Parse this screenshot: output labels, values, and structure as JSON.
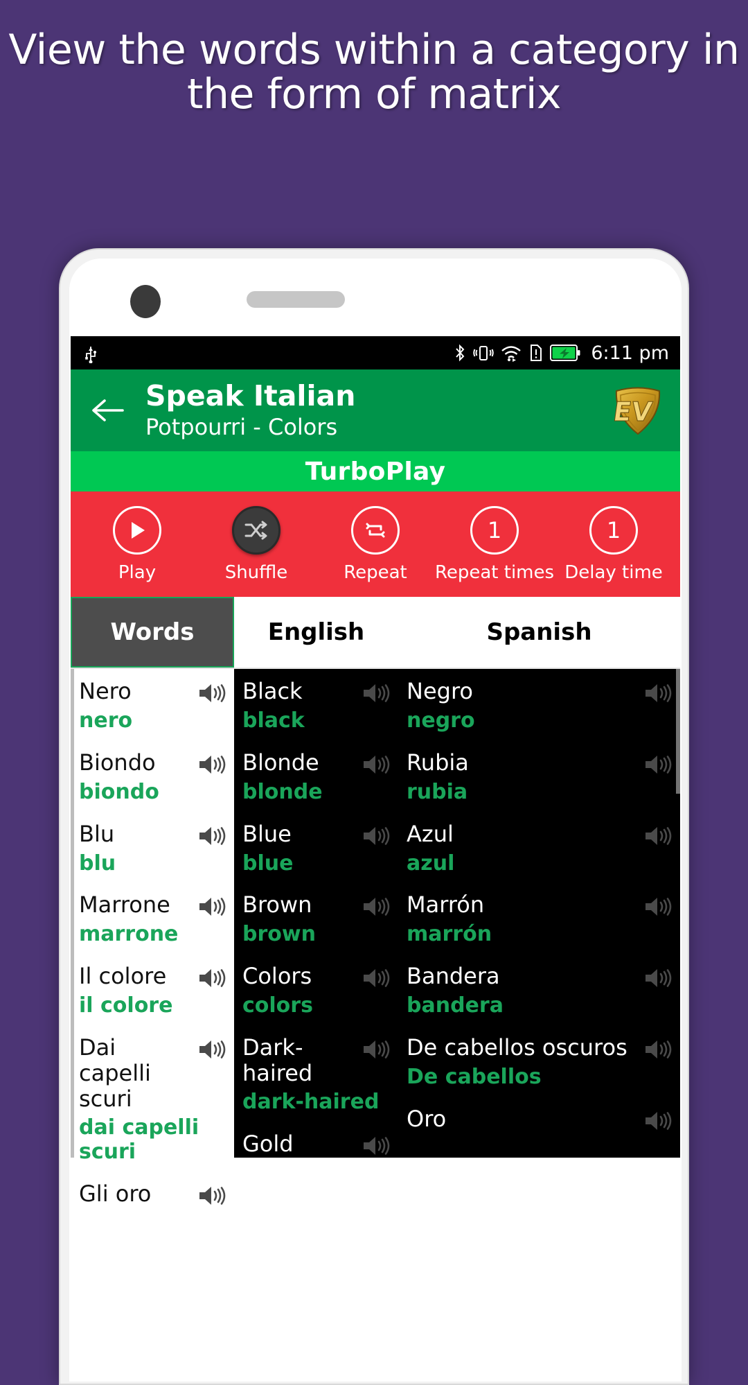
{
  "promo": {
    "headline": "View the words within a category in the form of matrix",
    "background_color": "#4c3575"
  },
  "statusbar": {
    "time": "6:11 pm",
    "left_icons": [
      "usb-icon"
    ],
    "right_icons": [
      "bluetooth-icon",
      "vibrate-icon",
      "wifi-icon",
      "sim-alert-icon",
      "battery-charging-icon"
    ]
  },
  "appbar": {
    "back_label": "←",
    "title": "Speak Italian",
    "subtitle": "Potpourri - Colors",
    "logo_text": "EV",
    "color": "#00944a"
  },
  "turboplay": {
    "label": "TurboPlay",
    "color": "#00c853"
  },
  "controls": {
    "bar_color": "#f0303c",
    "items": [
      {
        "label": "Play",
        "icon": "play-icon",
        "value": "",
        "active": false
      },
      {
        "label": "Shuffle",
        "icon": "shuffle-icon",
        "value": "",
        "active": true
      },
      {
        "label": "Repeat",
        "icon": "repeat-icon",
        "value": "",
        "active": false
      },
      {
        "label": "Repeat times",
        "icon": "number-icon",
        "value": "1",
        "active": false
      },
      {
        "label": "Delay time",
        "icon": "number-icon",
        "value": "1",
        "active": false
      }
    ]
  },
  "table": {
    "headers": {
      "words": "Words",
      "english": "English",
      "spanish": "Spanish"
    },
    "rows": [
      {
        "words_term": "Nero",
        "words_translit": "nero",
        "english_term": "Black",
        "english_translit": "black",
        "spanish_term": "Negro",
        "spanish_translit": "negro"
      },
      {
        "words_term": "Biondo",
        "words_translit": "biondo",
        "english_term": "Blonde",
        "english_translit": "blonde",
        "spanish_term": "Rubia",
        "spanish_translit": "rubia"
      },
      {
        "words_term": "Blu",
        "words_translit": "blu",
        "english_term": "Blue",
        "english_translit": "blue",
        "spanish_term": "Azul",
        "spanish_translit": "azul"
      },
      {
        "words_term": "Marrone",
        "words_translit": "marrone",
        "english_term": "Brown",
        "english_translit": "brown",
        "spanish_term": "Marrón",
        "spanish_translit": "marrón"
      },
      {
        "words_term": "Il colore",
        "words_translit": "il colore",
        "english_term": "Colors",
        "english_translit": "colors",
        "spanish_term": "Bandera",
        "spanish_translit": "bandera"
      },
      {
        "words_term": "Dai capelli scuri",
        "words_translit": "dai capelli scuri",
        "english_term": "Dark-haired",
        "english_translit": "dark-haired",
        "spanish_term": "De cabellos oscuros",
        "spanish_translit": "De cabellos"
      },
      {
        "words_term": "Gli oro",
        "words_translit": "",
        "english_term": "Gold",
        "english_translit": "",
        "spanish_term": "Oro",
        "spanish_translit": ""
      }
    ],
    "speaker_icon": "speaker-icon"
  },
  "colors": {
    "green_accent": "#1aa55a",
    "header_green": "#00944a",
    "turbo_green": "#00c853",
    "control_red": "#f0303c",
    "selected_tab": "#4d4d4d"
  }
}
